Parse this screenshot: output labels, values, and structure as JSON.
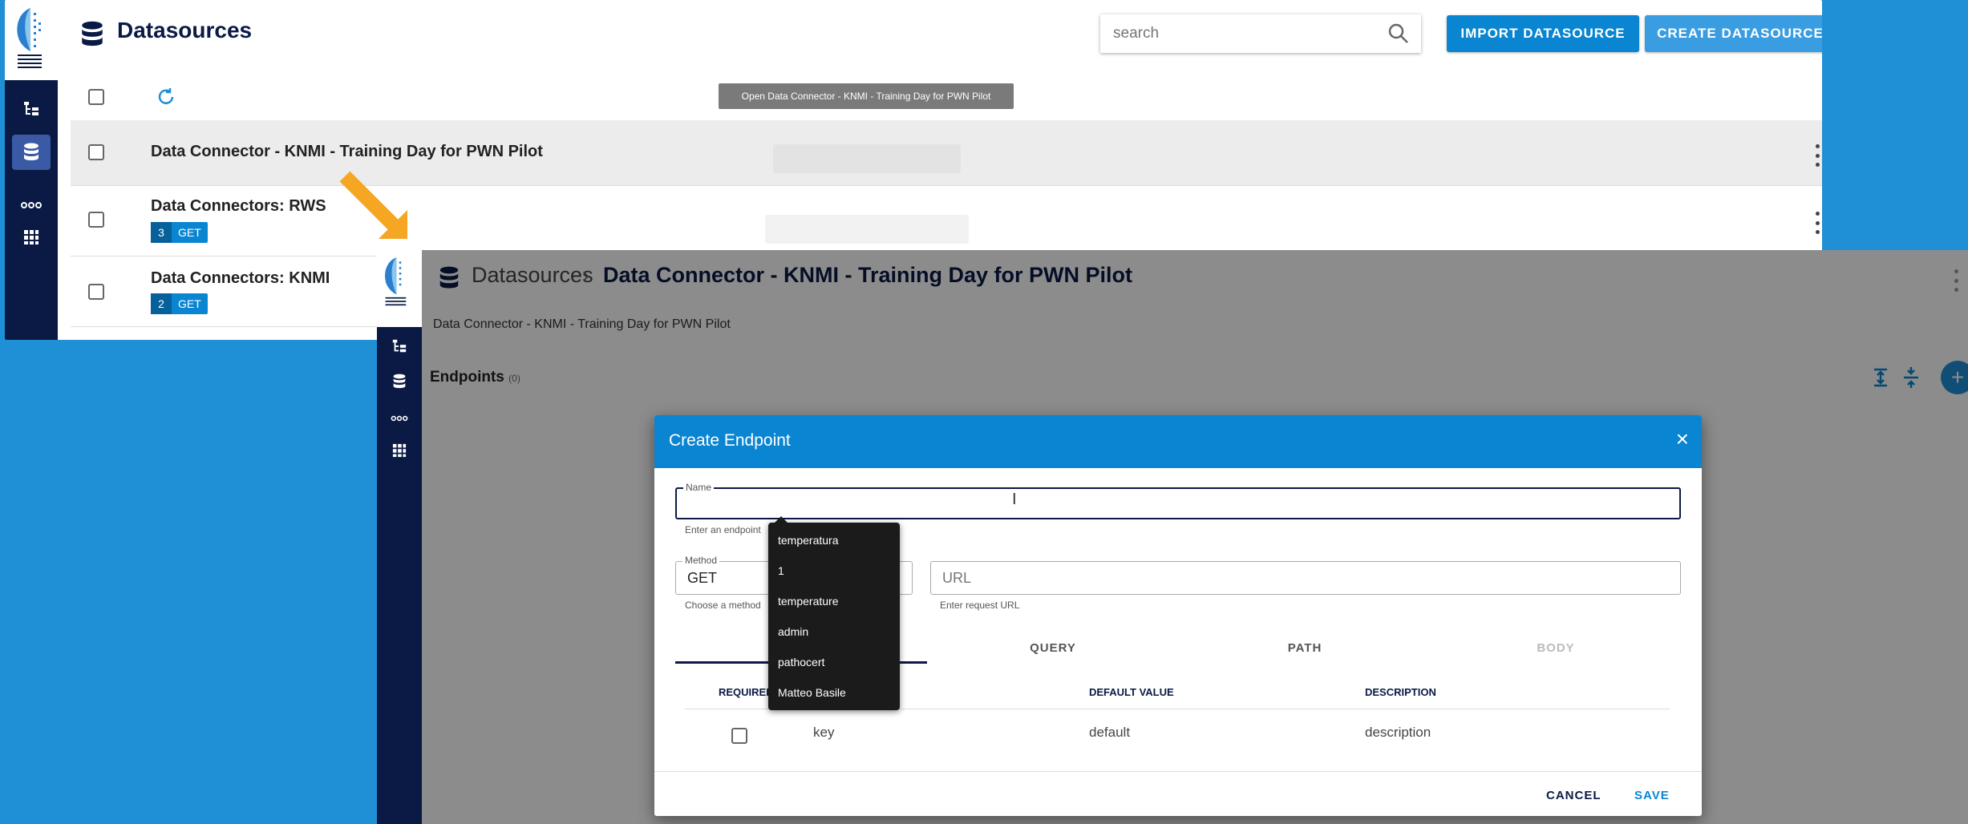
{
  "top_screen": {
    "header": {
      "title": "Datasources",
      "search": {
        "placeholder": "search",
        "value": ""
      },
      "import_button": "IMPORT DATASOURCE",
      "create_button": "CREATE DATASOURCE"
    },
    "tooltip": "Open Data Connector - KNMI - Training Day for PWN Pilot",
    "rows": [
      {
        "title": "Data Connector - KNMI - Training Day for PWN Pilot"
      },
      {
        "title": "Data Connectors: RWS",
        "count": "3",
        "method": "GET"
      },
      {
        "title": "Data Connectors: KNMI",
        "count": "2",
        "method": "GET"
      }
    ]
  },
  "bottom_screen": {
    "breadcrumb": {
      "parent": "Datasources",
      "separator": "›",
      "current": "Data Connector - KNMI - Training Day for PWN Pilot"
    },
    "subtitle": "Data Connector - KNMI - Training Day for PWN Pilot",
    "endpoints": {
      "label": "Endpoints",
      "count": "(0)"
    },
    "dialog": {
      "title": "Create Endpoint",
      "close": "×",
      "name": {
        "label": "Name",
        "value": "",
        "hint": "Enter an endpoint"
      },
      "method": {
        "label": "Method",
        "value": "GET",
        "hint": "Choose a method"
      },
      "url": {
        "placeholder": "URL",
        "hint": "Enter request URL"
      },
      "tabs": [
        "",
        "QUERY",
        "PATH",
        "BODY"
      ],
      "table": {
        "headers": [
          "REQUIRED",
          "DEFAULT VALUE",
          "DESCRIPTION"
        ],
        "row": {
          "key": "key",
          "default": "default",
          "description": "description"
        }
      },
      "cancel": "CANCEL",
      "save": "SAVE"
    },
    "autocomplete": [
      "temperatura",
      "1",
      "temperature",
      "admin",
      "pathocert",
      "Matteo Basile"
    ]
  },
  "colors": {
    "accent": "#0a85d1",
    "nav": "#0a1a45",
    "backdrop": "#1f8fd6",
    "arrow": "#f5a623"
  },
  "icons": [
    "tree-icon",
    "database-icon",
    "connector-icon",
    "grid-icon",
    "search-icon",
    "refresh-icon",
    "kebab-icon",
    "close-icon"
  ]
}
